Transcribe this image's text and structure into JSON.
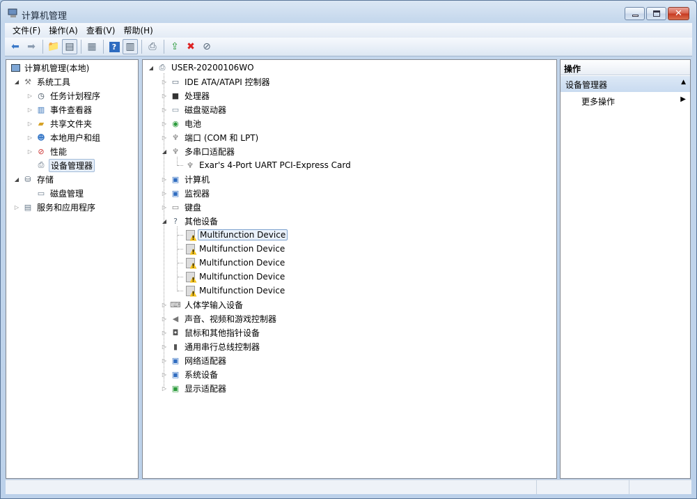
{
  "window": {
    "title": "计算机管理"
  },
  "menubar": [
    "文件(F)",
    "操作(A)",
    "查看(V)",
    "帮助(H)"
  ],
  "toolbar": [
    "back-icon",
    "forward-icon",
    "up-folder-icon",
    "show-hide-tree-icon",
    "properties-icon",
    "help-icon",
    "show-hide-action-pane-icon",
    "scan-hardware-icon",
    "update-driver-icon",
    "uninstall-icon",
    "disable-icon"
  ],
  "left_tree": {
    "root": "计算机管理(本地)",
    "system_tools": "系统工具",
    "task_scheduler": "任务计划程序",
    "event_viewer": "事件查看器",
    "shared_folders": "共享文件夹",
    "local_users": "本地用户和组",
    "performance": "性能",
    "device_manager": "设备管理器",
    "storage": "存储",
    "disk_management": "磁盘管理",
    "services_apps": "服务和应用程序"
  },
  "device_tree": {
    "root": "USER-20200106WO",
    "ide": "IDE ATA/ATAPI 控制器",
    "cpu": "处理器",
    "disk": "磁盘驱动器",
    "battery": "电池",
    "ports": "端口 (COM 和 LPT)",
    "multiport": "多串口适配器",
    "multiport_child": "Exar's 4-Port UART PCI-Express Card",
    "computer": "计算机",
    "monitor": "监视器",
    "keyboard": "键盘",
    "other": "其他设备",
    "other_children": [
      "Multifunction Device",
      "Multifunction Device",
      "Multifunction Device",
      "Multifunction Device",
      "Multifunction Device"
    ],
    "hid": "人体学输入设备",
    "sound": "声音、视频和游戏控制器",
    "mouse": "鼠标和其他指针设备",
    "usb": "通用串行总线控制器",
    "network": "网络适配器",
    "system": "系统设备",
    "display": "显示适配器"
  },
  "actions": {
    "header": "操作",
    "section": "设备管理器",
    "more": "更多操作"
  }
}
